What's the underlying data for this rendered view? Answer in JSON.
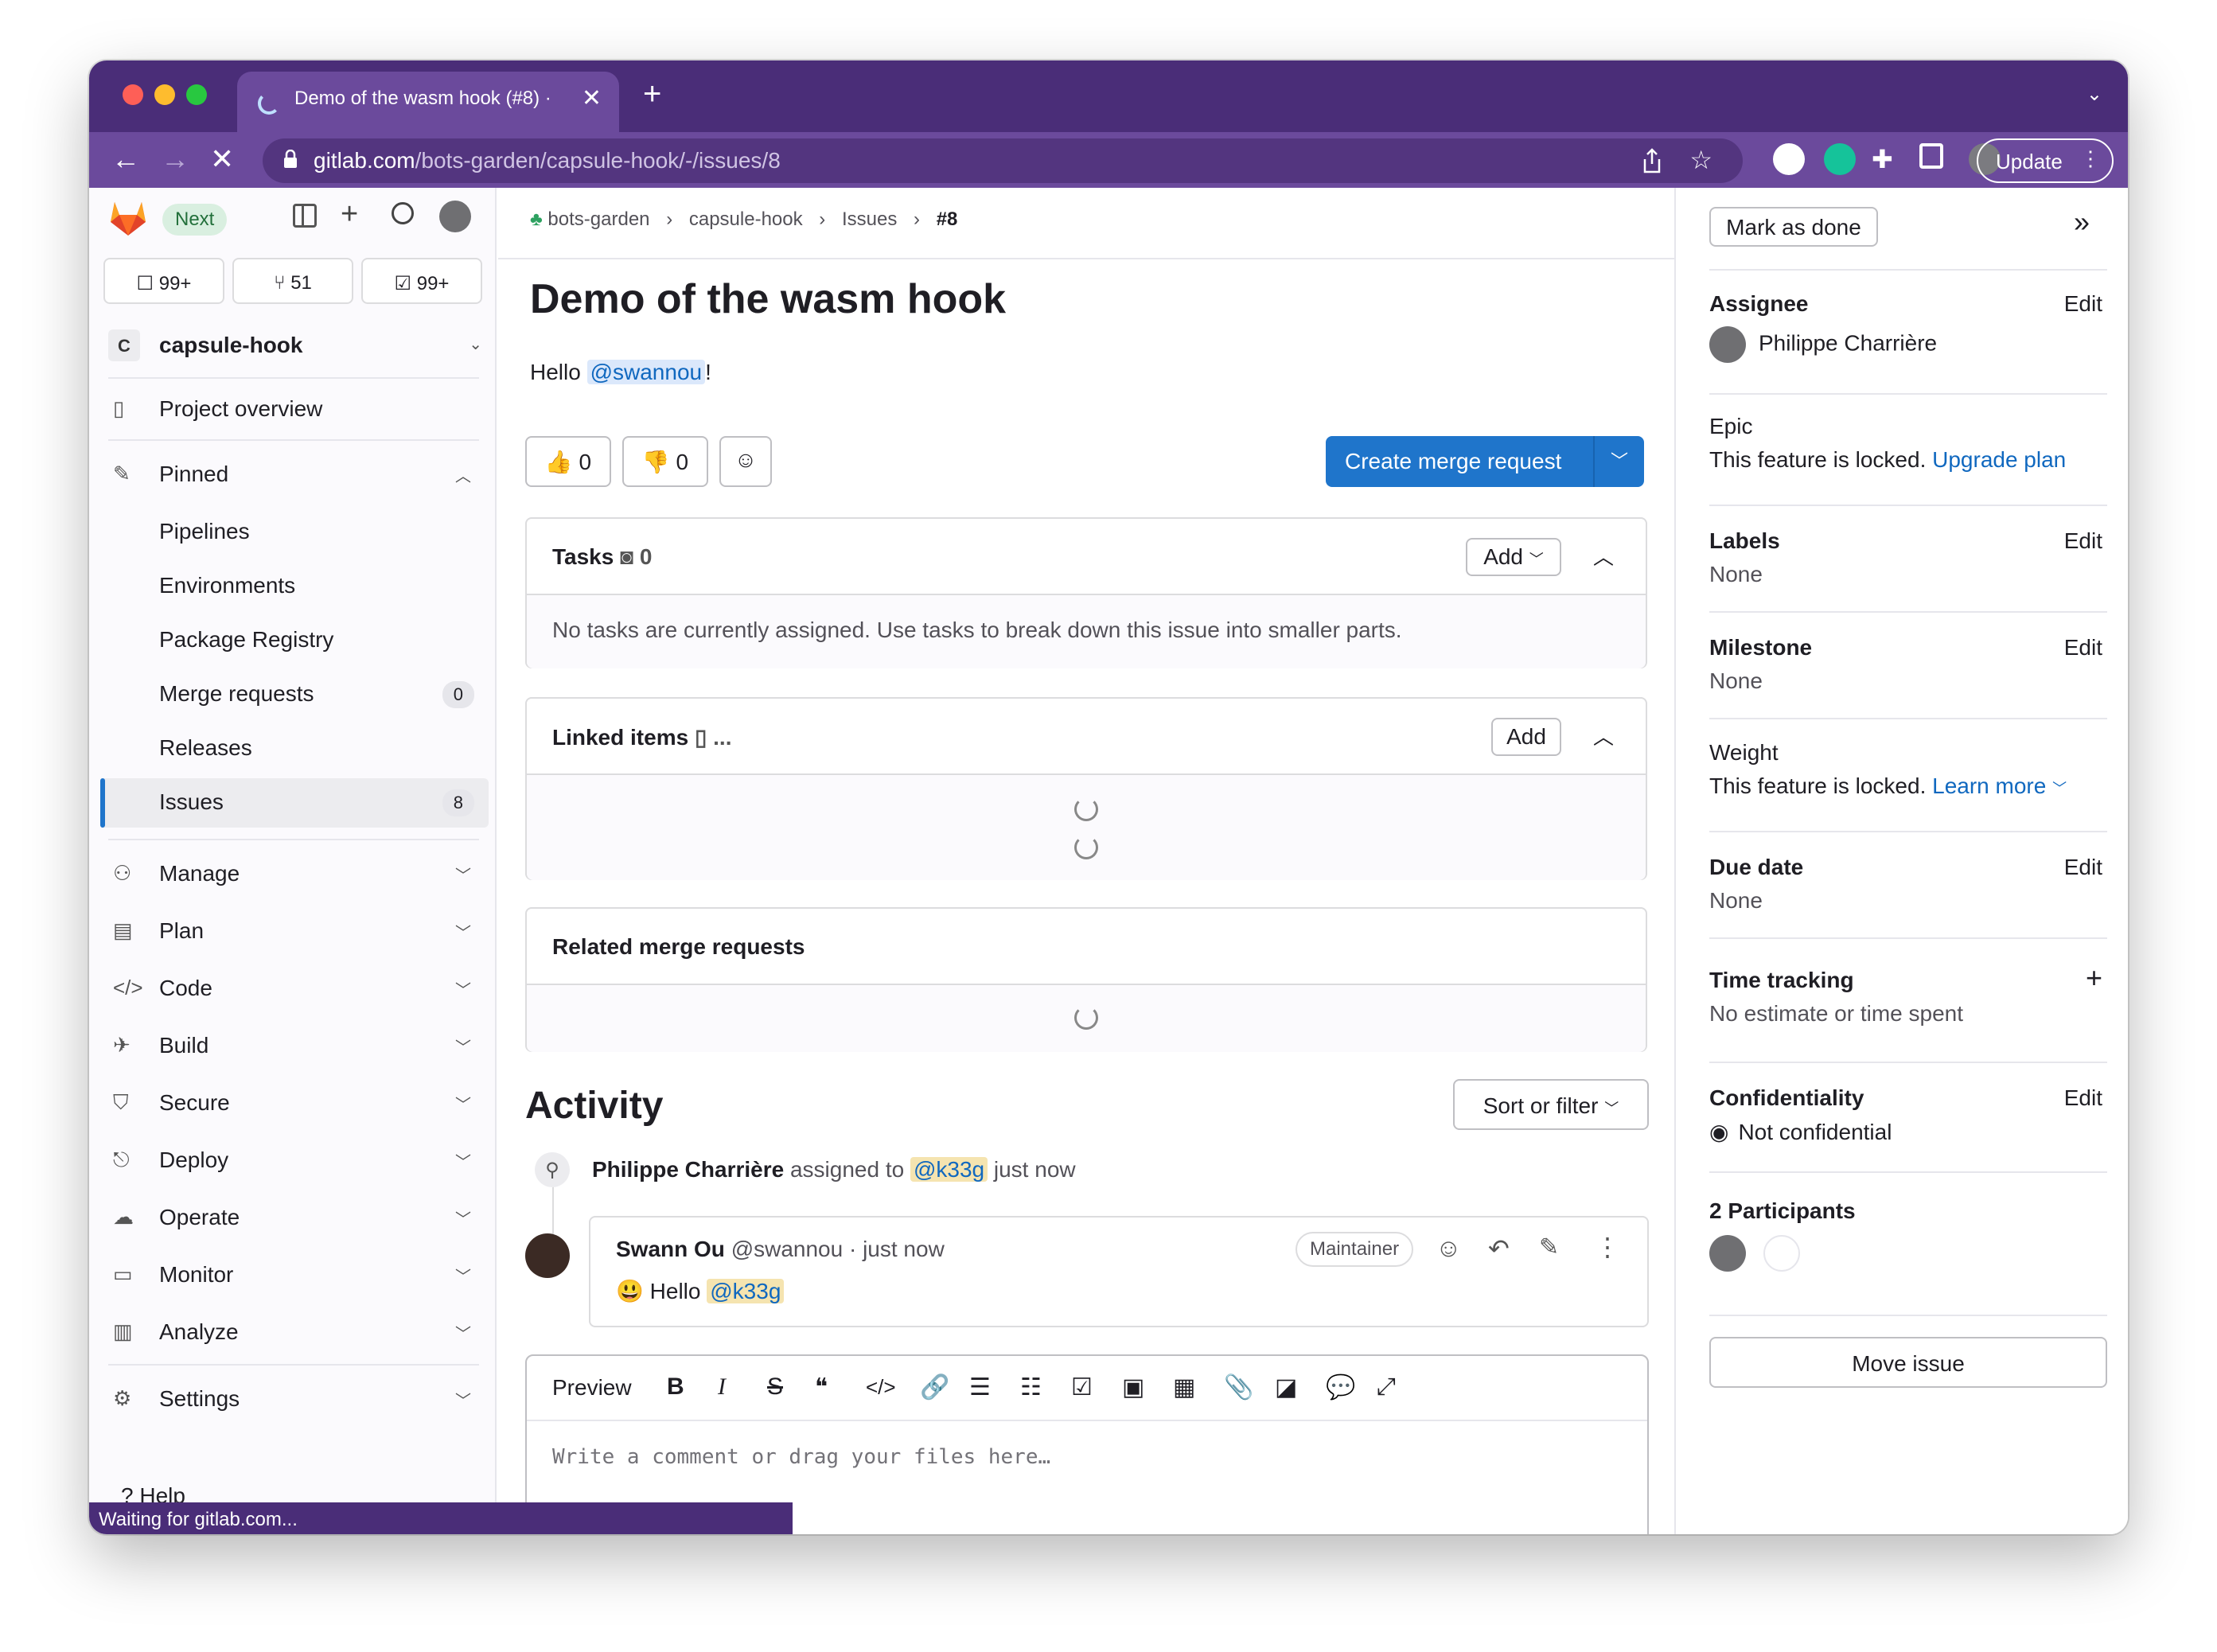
{
  "browser": {
    "tab_title": "Demo of the wasm hook (#8) ·",
    "url_host": "gitlab.com",
    "url_path": "/bots-garden/capsule-hook/-/issues/8",
    "update_label": "Update",
    "status": "Waiting for gitlab.com..."
  },
  "sidebar": {
    "next_badge": "Next",
    "counts": [
      "99+",
      "51",
      "99+"
    ],
    "project_initial": "C",
    "project_name": "capsule-hook",
    "overview": "Project overview",
    "pinned": "Pinned",
    "pinned_items": [
      {
        "label": "Pipelines"
      },
      {
        "label": "Environments"
      },
      {
        "label": "Package Registry"
      },
      {
        "label": "Merge requests",
        "count": "0"
      },
      {
        "label": "Releases"
      },
      {
        "label": "Issues",
        "count": "8"
      }
    ],
    "groups": [
      "Manage",
      "Plan",
      "Code",
      "Build",
      "Secure",
      "Deploy",
      "Operate",
      "Monitor",
      "Analyze"
    ],
    "settings": "Settings",
    "help": "Help"
  },
  "breadcrumb": [
    "bots-garden",
    "capsule-hook",
    "Issues",
    "#8"
  ],
  "issue": {
    "title": "Demo of the wasm hook",
    "hello": "Hello",
    "mention": "@swannou",
    "bang": "!",
    "thumbs_up": "0",
    "thumbs_down": "0",
    "create_mr": "Create merge request"
  },
  "tasks": {
    "title": "Tasks",
    "count": "0",
    "add": "Add",
    "empty": "No tasks are currently assigned. Use tasks to break down this issue into smaller parts."
  },
  "linked": {
    "title": "Linked items",
    "more": "...",
    "add": "Add"
  },
  "related_mr": {
    "title": "Related merge requests"
  },
  "activity": {
    "title": "Activity",
    "sort": "Sort or filter",
    "event_author": "Philippe Charrière",
    "event_text": "assigned to",
    "event_mention": "@k33g",
    "event_time": "just now",
    "comment_author": "Swann Ou",
    "comment_handle": "@swannou · just now",
    "comment_role": "Maintainer",
    "comment_hello": "Hello",
    "comment_mention": "@k33g",
    "comment_emoji": "😃"
  },
  "editor": {
    "preview": "Preview",
    "placeholder": "Write a comment or drag your files here…"
  },
  "right": {
    "mark_done": "Mark as done",
    "assignee_title": "Assignee",
    "assignee_name": "Philippe Charrière",
    "edit": "Edit",
    "epic_title": "Epic",
    "epic_text": "This feature is locked.",
    "epic_link": "Upgrade plan",
    "labels_title": "Labels",
    "labels_value": "None",
    "milestone_title": "Milestone",
    "milestone_value": "None",
    "weight_title": "Weight",
    "weight_text": "This feature is locked.",
    "weight_link": "Learn more",
    "due_title": "Due date",
    "due_value": "None",
    "time_title": "Time tracking",
    "time_value": "No estimate or time spent",
    "conf_title": "Confidentiality",
    "conf_value": "Not confidential",
    "participants": "2 Participants",
    "move": "Move issue"
  },
  "colors": {
    "brand": "#4a2d78",
    "accent": "#1f75cb",
    "link": "#1068bf"
  }
}
